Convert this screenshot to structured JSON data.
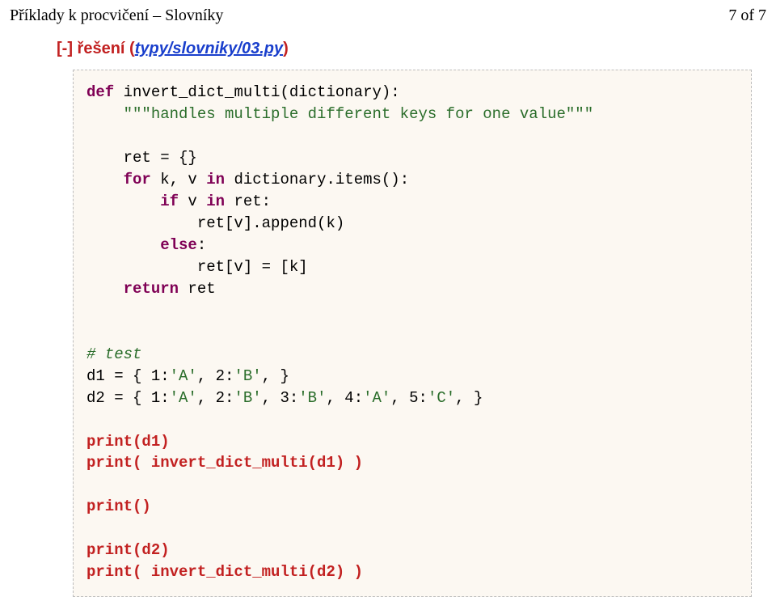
{
  "header": {
    "title": "Příklady k procvičení – Slovníky",
    "page_indicator": "7 of 7"
  },
  "section": {
    "prefix": "[-] řešení (",
    "link_text": "typy/slovniky/03.py",
    "trailing": ")"
  },
  "code": {
    "l01a": "def",
    "l01b": " invert_dict_multi(dictionary):",
    "l02": "    \"\"\"handles multiple different keys for one value\"\"\"",
    "blank1": "",
    "l03": "    ret = {}",
    "l04a": "    ",
    "l04b": "for",
    "l04c": " k, v ",
    "l04d": "in",
    "l04e": " dictionary.items():",
    "l05a": "        ",
    "l05b": "if",
    "l05c": " v ",
    "l05d": "in",
    "l05e": " ret:",
    "l06": "            ret[v].append(k)",
    "l07a": "        ",
    "l07b": "else",
    "l07c": ":",
    "l08": "            ret[v] = [k]",
    "l09a": "    ",
    "l09b": "return",
    "l09c": " ret",
    "blank2": "",
    "blank3": "",
    "l10": "# test",
    "l11a": "d1 = { 1:",
    "l11b": "'A'",
    "l11c": ", 2:",
    "l11d": "'B'",
    "l11e": ", }",
    "l12a": "d2 = { 1:",
    "l12b": "'A'",
    "l12c": ", 2:",
    "l12d": "'B'",
    "l12e": ", 3:",
    "l12f": "'B'",
    "l12g": ", 4:",
    "l12h": "'A'",
    "l12i": ", 5:",
    "l12j": "'C'",
    "l12k": ", }",
    "blank4": "",
    "l13": "print(d1)",
    "l14": "print( invert_dict_multi(d1) )",
    "blank5": "",
    "l15": "print()",
    "blank6": "",
    "l16": "print(d2)",
    "l17": "print( invert_dict_multi(d2) )"
  }
}
